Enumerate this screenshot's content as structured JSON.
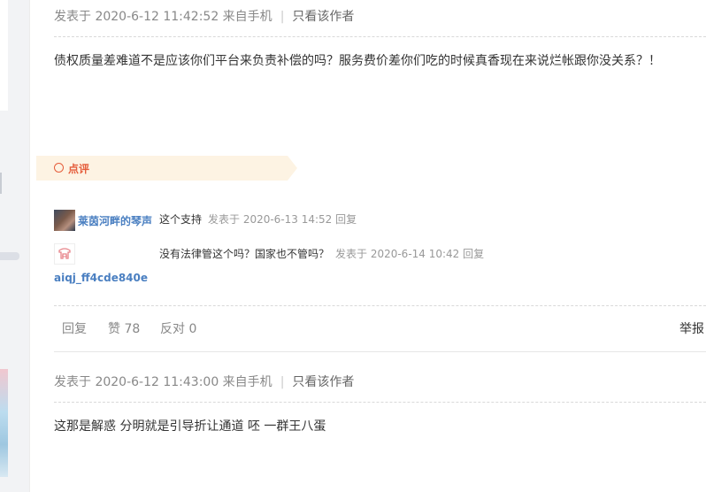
{
  "post1": {
    "meta_time": "发表于 2020-6-12 11:42:52 来自手机",
    "meta_sep": "|",
    "only_author": "只看该作者",
    "content": "债权质量差难道不是应该你们平台来负责补偿的吗？服务费价差你们吃的时候真香现在来说烂帐跟你没关系？！"
  },
  "review": {
    "label": "点评",
    "comments": [
      {
        "user": "莱茵河畔的琴声",
        "text": "这个支持",
        "time": "发表于 2020-6-13 14:52",
        "reply": "回复"
      },
      {
        "user": "aiqj_ff4cde840e",
        "text": "没有法律管这个吗？国家也不管吗？",
        "time": "发表于 2020-6-14 10:42",
        "reply": "回复"
      }
    ]
  },
  "actions": {
    "reply": "回复",
    "like": "赞 78",
    "oppose": "反对 0",
    "report": "举报"
  },
  "post2": {
    "meta_time": "发表于 2020-6-12 11:43:00 来自手机",
    "meta_sep": "|",
    "only_author": "只看该作者",
    "content": "这那是解惑 分明就是引导折让通道 呸 一群王八蛋"
  },
  "colors": {
    "accent": "#e55d3b",
    "link": "#4a7fc1",
    "banner_bg": "#fdf3e3"
  },
  "icons": [
    "avatar-photo-icon",
    "avatar-default-icon",
    "review-circle-icon"
  ]
}
